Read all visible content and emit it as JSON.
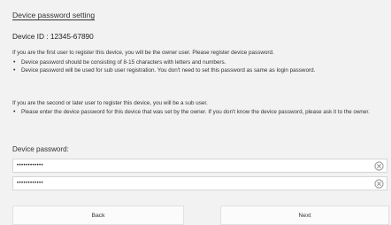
{
  "page": {
    "title": "Device password setting",
    "device_id": "Device ID : 12345-67890"
  },
  "owner_section": {
    "intro": "If you are the first user to register this device, you will be the owner user. Please register device password.",
    "bullets": [
      "Device password should be consisting of 8-15 characters with letters and numbers.",
      "Device password will be used for sub user registration. You don't need to set this password as same as login password."
    ]
  },
  "sub_user_section": {
    "intro": "If you are the second or later user to register this device, you will be a sub user.",
    "bullets": [
      "Please enter the device password for this device that was set by the owner. If you don't know the device password, please ask it to the owner."
    ]
  },
  "password": {
    "label": "Device password:",
    "field1_value": "••••••••••••",
    "field2_value": "••••••••••••"
  },
  "buttons": {
    "back": "Back",
    "next": "Next"
  },
  "icons": {
    "clear": "clear-icon"
  },
  "colors": {
    "background": "#f2f2f2",
    "text": "#333333",
    "field_border": "#d6d6d6",
    "button_bg": "#fbfbfb"
  }
}
